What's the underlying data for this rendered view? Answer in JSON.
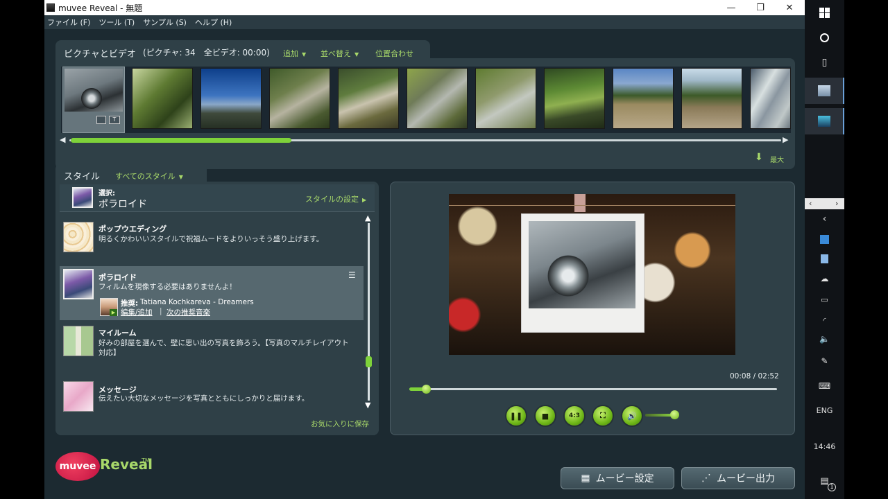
{
  "window": {
    "title": "muvee Reveal - 無題",
    "minimize": "—",
    "restore": "❐",
    "close": "✕"
  },
  "menu": [
    "ファイル (F)",
    "ツール (T)",
    "サンプル (S)",
    "ヘルプ (H)"
  ],
  "pictures": {
    "title": "ピクチャとビデオ",
    "counts": "(ピクチャ: 34　全ビデオ: 00:00)",
    "add": "追加",
    "sort": "並べ替え",
    "align": "位置合わせ",
    "max": "最大",
    "scroll_fraction": 0.31,
    "thumbs": [
      {
        "name": "photo-car-wheel"
      },
      {
        "name": "photo-bamboo"
      },
      {
        "name": "photo-mountain-sky"
      },
      {
        "name": "photo-forest-path"
      },
      {
        "name": "photo-forest-rail"
      },
      {
        "name": "photo-stream"
      },
      {
        "name": "photo-stream-2"
      },
      {
        "name": "photo-log-bridge"
      },
      {
        "name": "photo-beach"
      },
      {
        "name": "photo-hill"
      },
      {
        "name": "photo-light"
      }
    ]
  },
  "styles": {
    "tab": "スタイル",
    "filter": "すべてのスタイル",
    "selected_label": "選択:",
    "selected_name": "ポラロイド",
    "settings": "スタイルの設定",
    "favorite": "お気に入りに保存",
    "items": [
      {
        "name": "ポップウエディング",
        "desc": "明るくかわいいスタイルで祝福ムードをよりいっそう盛り上げます。"
      },
      {
        "name": "ポラロイド",
        "desc": "フィルムを現像する必要はありませんよ！",
        "rec_label": "推奨:",
        "rec_song": "Tatiana Kochkareva - Dreamers",
        "edit": "編集/追加",
        "sep": "|",
        "next": "次の推奨音楽"
      },
      {
        "name": "マイルーム",
        "desc": "好みの部屋を選んで、壁に思い出の写真を飾ろう。【写真のマルチレイアウト対応】"
      },
      {
        "name": "メッセージ",
        "desc": "伝えたい大切なメッセージを写真とともにしっかりと届けます。"
      }
    ]
  },
  "preview": {
    "time": "00:08 / 02:52",
    "progress": 0.045,
    "ratio_label": "4:3",
    "volume": 0.9
  },
  "buttons": {
    "movie_settings": "ムービー設定",
    "movie_output": "ムービー出力"
  },
  "logo": {
    "text1": "muvee",
    "text2": "Reveal",
    "tm": "TM"
  },
  "taskbar": {
    "lang": "ENG",
    "clock": "14:46",
    "notif_count": "1"
  },
  "colors": {
    "accent_green": "#7ed23a",
    "panel": "#2f4047",
    "background": "#1c2a31"
  }
}
